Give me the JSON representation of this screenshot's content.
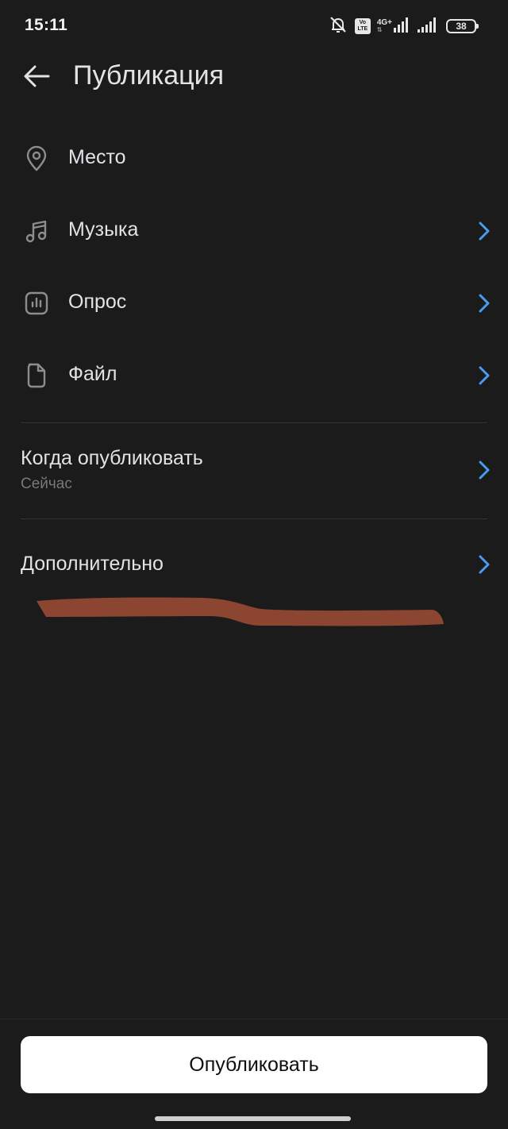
{
  "status_bar": {
    "time": "15:11",
    "volte_top": "Vo",
    "volte_bottom": "LTE",
    "network": "4G+",
    "battery": "38"
  },
  "header": {
    "title": "Публикация"
  },
  "options": [
    {
      "label": "Место",
      "icon": "location-pin-icon",
      "has_chevron": false
    },
    {
      "label": "Музыка",
      "icon": "music-note-icon",
      "has_chevron": true
    },
    {
      "label": "Опрос",
      "icon": "poll-chart-icon",
      "has_chevron": true
    },
    {
      "label": "Файл",
      "icon": "file-icon",
      "has_chevron": true
    }
  ],
  "schedule": {
    "label": "Когда опубликовать",
    "value": "Сейчас"
  },
  "advanced": {
    "label": "Дополнительно"
  },
  "footer": {
    "publish_label": "Опубликовать"
  },
  "colors": {
    "background": "#1b1b1b",
    "text_primary": "#e1e3e6",
    "text_secondary": "#76787a",
    "icon": "#8b8d90",
    "accent": "#4a9cf0",
    "redaction": "#8b4530",
    "button_bg": "#ffffff"
  }
}
